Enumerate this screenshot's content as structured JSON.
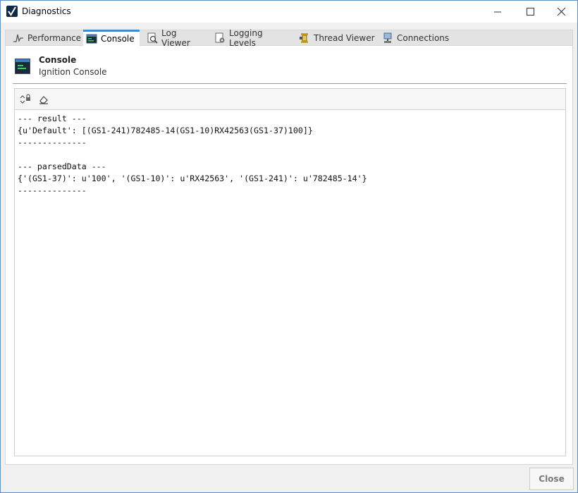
{
  "window": {
    "title": "Diagnostics",
    "accent_color": "#3d8bd6"
  },
  "tabs": [
    {
      "label": "Performance",
      "icon": "performance-icon"
    },
    {
      "label": "Console",
      "icon": "console-icon",
      "active": true
    },
    {
      "label": "Log Viewer",
      "icon": "log-viewer-icon"
    },
    {
      "label": "Logging Levels",
      "icon": "logging-levels-icon"
    },
    {
      "label": "Thread Viewer",
      "icon": "thread-viewer-icon"
    },
    {
      "label": "Connections",
      "icon": "connections-icon"
    }
  ],
  "header": {
    "title": "Console",
    "subtitle": "Ignition Console"
  },
  "toolbar": {
    "buttons": [
      "scroll-lock-icon",
      "clear-eraser-icon"
    ]
  },
  "console": {
    "lines": [
      "--- result ---",
      "{u'Default': [(GS1-241)782485-14(GS1-10)RX42563(GS1-37)100]}",
      "--------------",
      "",
      "--- parsedData ---",
      "{'(GS1-37)': u'100', '(GS1-10)': u'RX42563', '(GS1-241)': u'782485-14'}",
      "--------------"
    ]
  },
  "footer": {
    "close_label": "Close"
  }
}
